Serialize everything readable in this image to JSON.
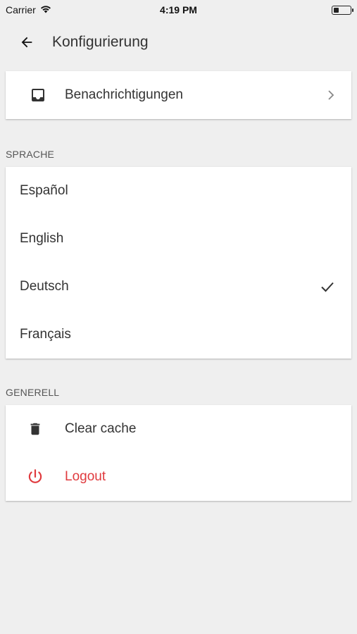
{
  "status_bar": {
    "carrier": "Carrier",
    "time": "4:19 PM",
    "battery_level": 0.3
  },
  "header": {
    "title": "Konfigurierung",
    "back_icon": "arrow-left-icon"
  },
  "notifications": {
    "label": "Benachrichtigungen",
    "icon": "inbox-icon",
    "chevron": "chevron-right-icon"
  },
  "language": {
    "header": "SPRACHE",
    "options": [
      {
        "label": "Español",
        "selected": false
      },
      {
        "label": "English",
        "selected": false
      },
      {
        "label": "Deutsch",
        "selected": true
      },
      {
        "label": "Français",
        "selected": false
      }
    ]
  },
  "general": {
    "header": "GENERELL",
    "clear_cache": {
      "label": "Clear cache",
      "icon": "trash-icon"
    },
    "logout": {
      "label": "Logout",
      "icon": "power-icon"
    }
  },
  "colors": {
    "background": "#efefef",
    "accent_red": "#e03a3e",
    "text": "#333333"
  }
}
